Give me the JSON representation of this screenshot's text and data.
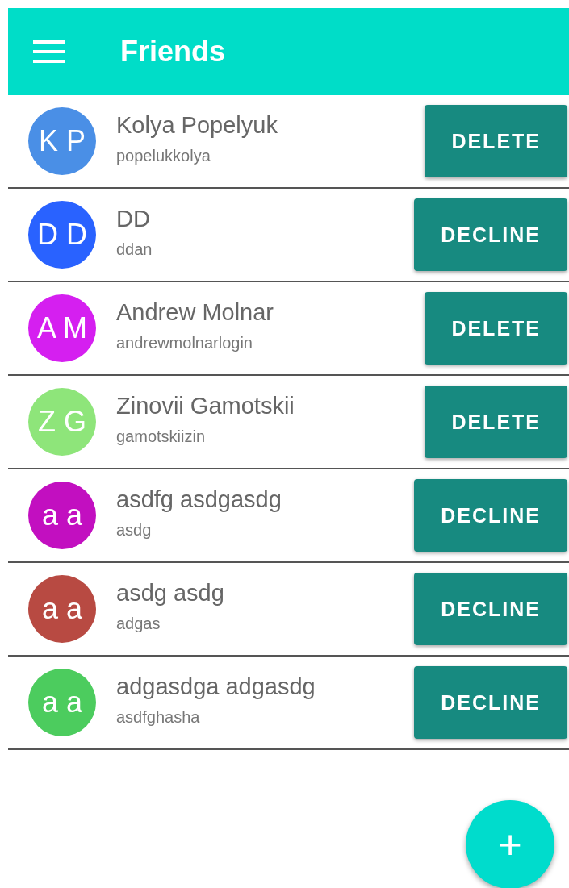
{
  "app_bar": {
    "title": "Friends"
  },
  "friends": [
    {
      "initials": "K P",
      "name": "Kolya Popelyuk",
      "login": "popelukkolya",
      "color": "#4a8fe6",
      "action": "DELETE"
    },
    {
      "initials": "D D",
      "name": "DD",
      "login": "ddan",
      "color": "#2962ff",
      "action": "DECLINE"
    },
    {
      "initials": "A M",
      "name": "Andrew Molnar",
      "login": "andrewmolnarlogin",
      "color": "#d51ff0",
      "action": "DELETE"
    },
    {
      "initials": "Z G",
      "name": "Zinovii Gamotskii",
      "login": "gamotskiizin",
      "color": "#8ee57a",
      "action": "DELETE"
    },
    {
      "initials": "a a",
      "name": "asdfg asdgasdg",
      "login": "asdg",
      "color": "#c20fc0",
      "action": "DECLINE"
    },
    {
      "initials": "a a",
      "name": "asdg asdg",
      "login": "adgas",
      "color": "#b84a42",
      "action": "DECLINE"
    },
    {
      "initials": "a a",
      "name": "adgasdga adgasdg",
      "login": "asdfghasha",
      "color": "#4ccc5e",
      "action": "DECLINE"
    }
  ],
  "fab": {
    "label": "+"
  }
}
